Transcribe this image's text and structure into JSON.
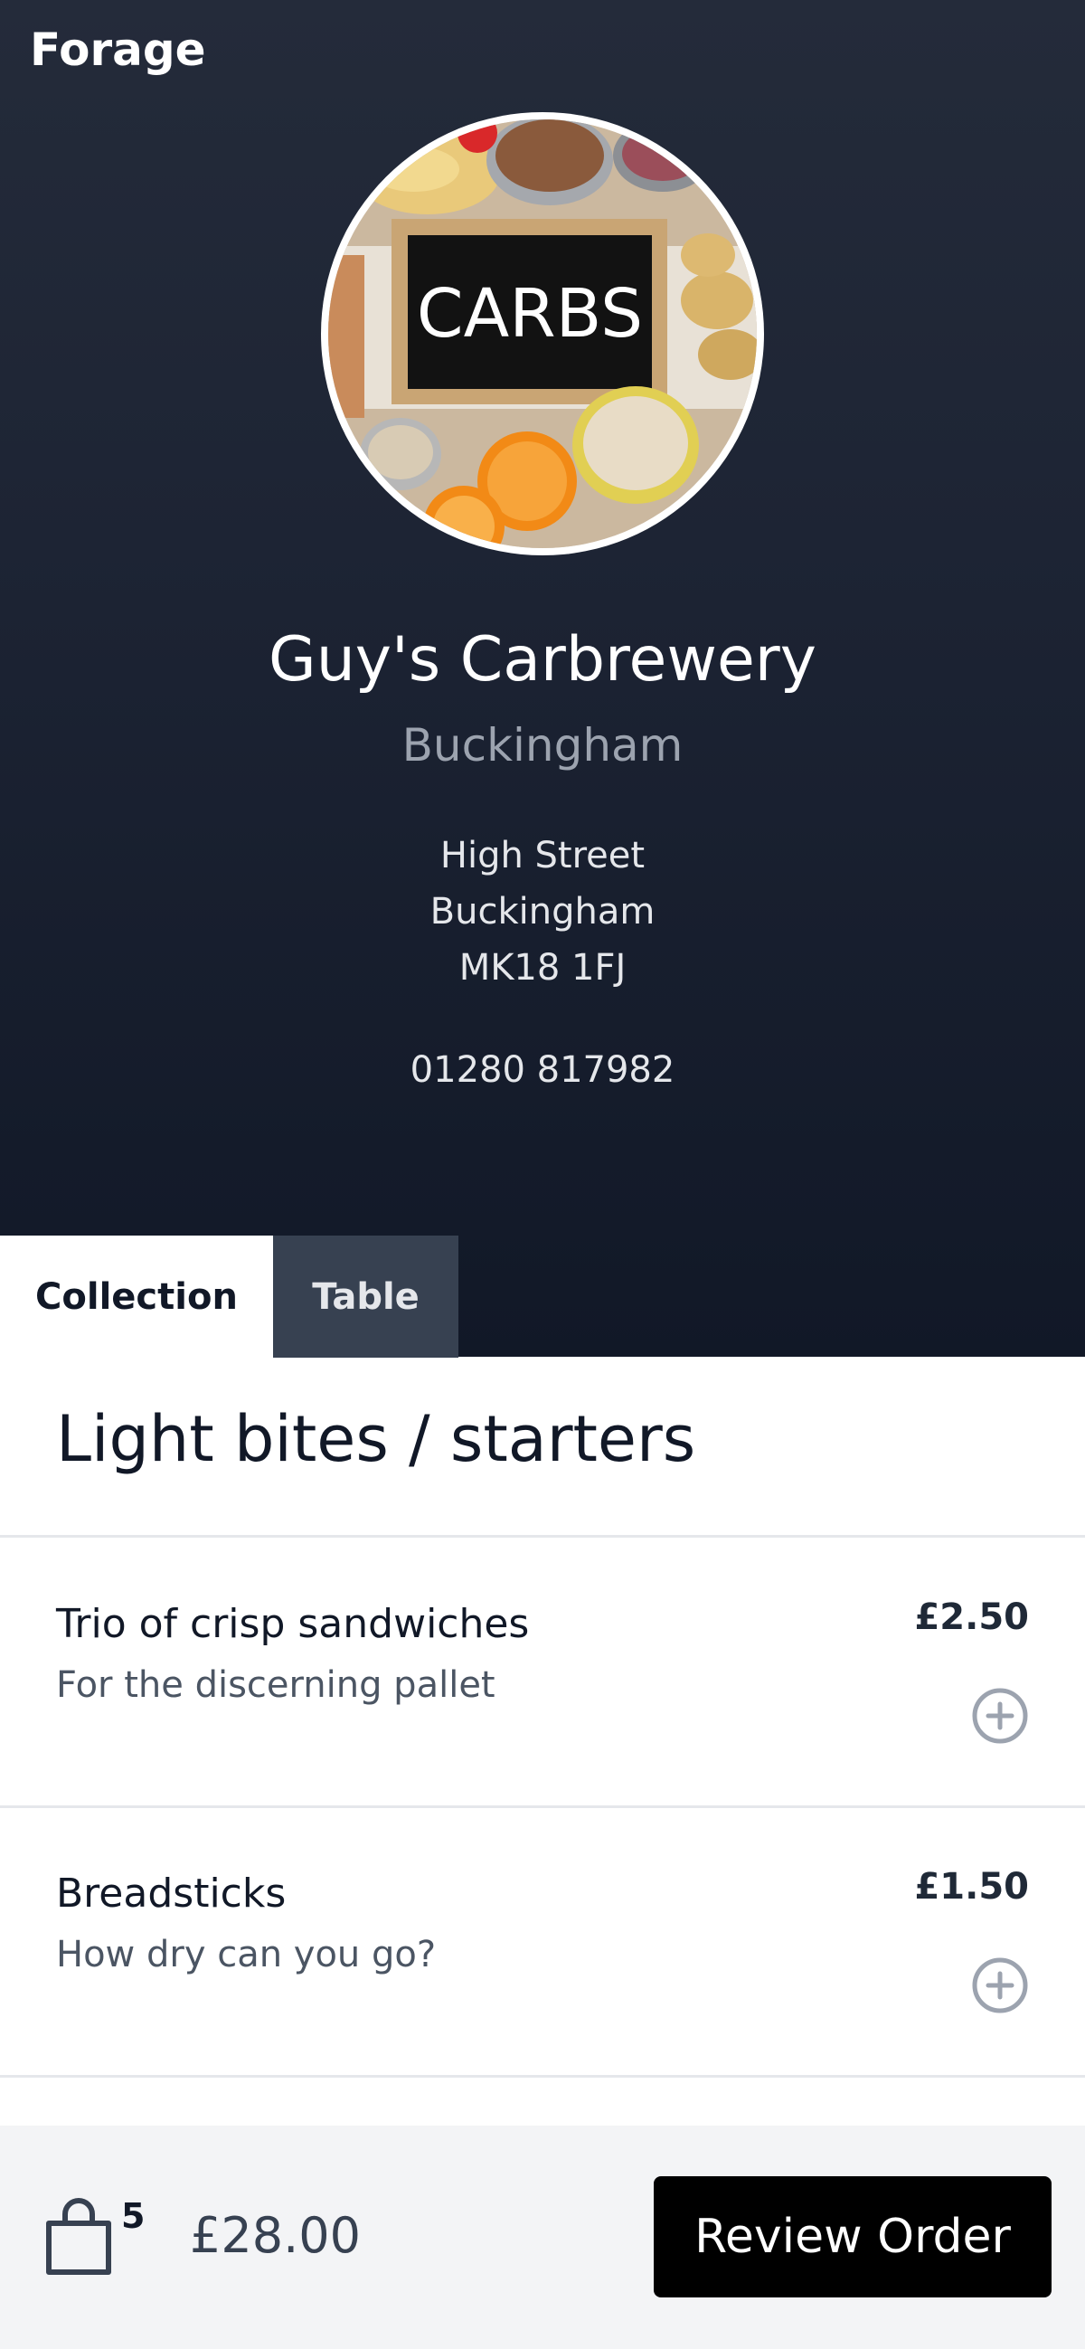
{
  "header": {
    "brand": "Forage"
  },
  "venue": {
    "name": "Guy's Carbrewery",
    "town": "Buckingham",
    "address": [
      "High Street",
      "Buckingham",
      "MK18 1FJ"
    ],
    "phone": "01280 817982",
    "image_label": "CARBS"
  },
  "tabs": [
    {
      "label": "Collection",
      "active": true
    },
    {
      "label": "Table",
      "active": false
    }
  ],
  "menu": {
    "section_title": "Light bites / starters",
    "items": [
      {
        "name": "Trio of crisp sandwiches",
        "description": "For the discerning pallet",
        "price": "£2.50"
      },
      {
        "name": "Breadsticks",
        "description": "How dry can you go?",
        "price": "£1.50"
      }
    ]
  },
  "basket": {
    "count": "5",
    "total": "£28.00",
    "review_label": "Review Order"
  },
  "colors": {
    "hero_background": "#1d2434",
    "tab_inactive": "#374151",
    "button": "#000000"
  }
}
